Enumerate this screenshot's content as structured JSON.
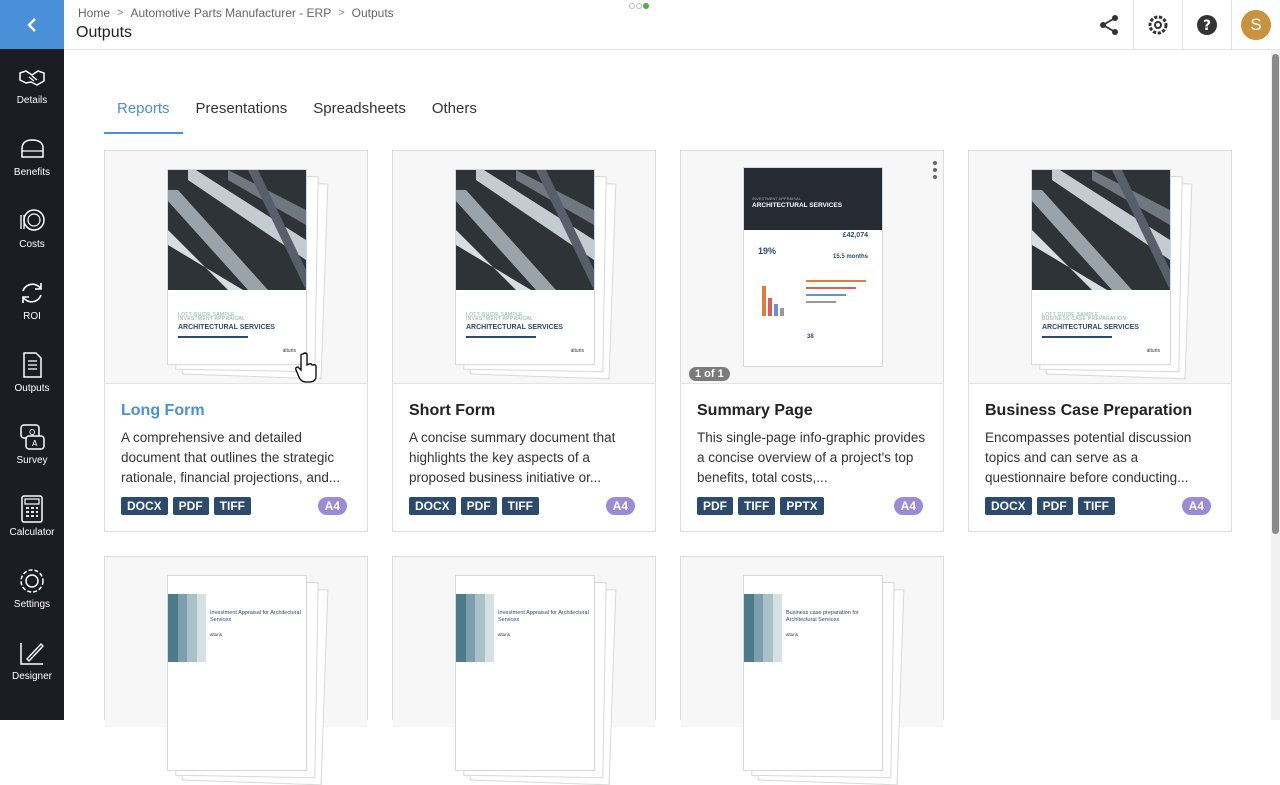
{
  "sidebar": {
    "items": [
      {
        "label": "Details",
        "icon": "handshake-icon"
      },
      {
        "label": "Benefits",
        "icon": "piggy-bank-icon"
      },
      {
        "label": "Costs",
        "icon": "coins-icon"
      },
      {
        "label": "ROI",
        "icon": "refresh-icon"
      },
      {
        "label": "Outputs",
        "icon": "document-icon"
      },
      {
        "label": "Survey",
        "icon": "survey-icon"
      },
      {
        "label": "Calculator",
        "icon": "calculator-icon"
      },
      {
        "label": "Settings",
        "icon": "gear-icon"
      },
      {
        "label": "Designer",
        "icon": "designer-icon"
      }
    ]
  },
  "header": {
    "breadcrumb": [
      "Home",
      "Automotive Parts Manufacturer - ERP",
      "Outputs"
    ],
    "title": "Outputs",
    "avatar_initial": "S"
  },
  "tabs": [
    "Reports",
    "Presentations",
    "Spreadsheets",
    "Others"
  ],
  "active_tab": "Reports",
  "cards": [
    {
      "title": "Long Form",
      "description": "A comprehensive and detailed document that outlines the strategic rationale, financial projections, and...",
      "formats": [
        "DOCX",
        "PDF",
        "TIFF"
      ],
      "size": "A4",
      "cover_kicker": "LOTT GUIDE SAMPLE",
      "cover_line": "INVESTMENT APPRAISAL",
      "cover_title": "ARCHITECTURAL SERVICES",
      "cover_logo": "alturis"
    },
    {
      "title": "Short Form",
      "description": "A concise summary document that highlights the key aspects of a proposed business initiative or...",
      "formats": [
        "DOCX",
        "PDF",
        "TIFF"
      ],
      "size": "A4",
      "cover_kicker": "LOTT GUIDE SAMPLE",
      "cover_line": "INVESTMENT APPRAISAL",
      "cover_title": "ARCHITECTURAL SERVICES",
      "cover_logo": "alturis"
    },
    {
      "title": "Summary Page",
      "description": "This single-page info-graphic provides a concise overview of a project's top benefits, total costs,...",
      "formats": [
        "PDF",
        "TIFF",
        "PPTX"
      ],
      "size": "A4",
      "page_badge": "1 of 1",
      "cover_line": "INVESTMENT APPRAISAL",
      "cover_title": "ARCHITECTURAL SERVICES",
      "stat_pct": "19%",
      "stat_value": "£42,074",
      "stat_months": "15.5 months",
      "stat_center": "38"
    },
    {
      "title": "Business Case Preparation",
      "description": "Encompasses potential discussion topics and can serve as a questionnaire before conducting...",
      "formats": [
        "DOCX",
        "PDF",
        "TIFF"
      ],
      "size": "A4",
      "cover_kicker": "LOTT GUIDE SAMPLE",
      "cover_line": "BUSINESS CASE PREPARATION",
      "cover_title": "ARCHITECTURAL SERVICES",
      "cover_logo": "alturis"
    }
  ],
  "row2": [
    {
      "title": "Investment Appraisal for Architectural Services",
      "logo": "alturis"
    },
    {
      "title": "Investment Appraisal for Architectural Services",
      "logo": "alturis"
    },
    {
      "title": "Business case preparation for Architectural Services",
      "logo": "alturis"
    }
  ]
}
